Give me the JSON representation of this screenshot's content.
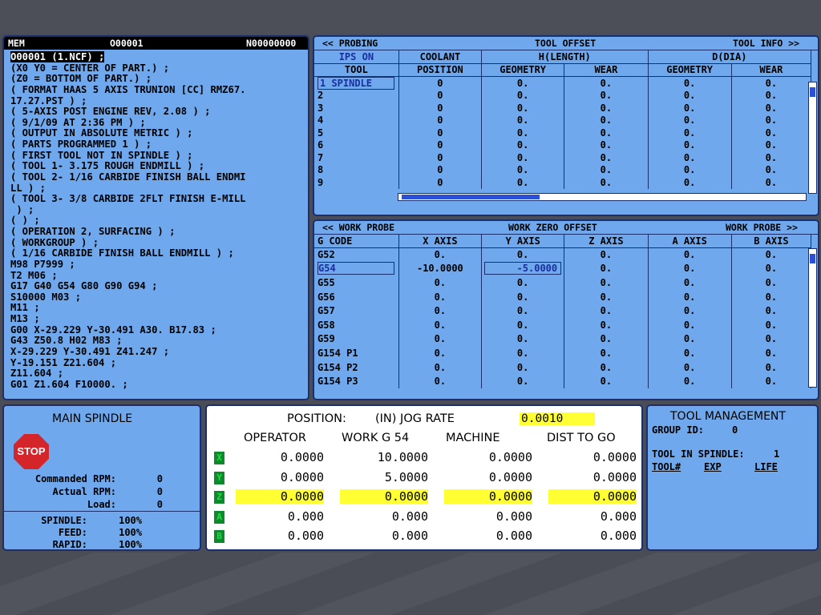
{
  "program": {
    "mode": "MEM",
    "number": "O00001",
    "seq": "N00000000",
    "lines": [
      "O00001 (1.NCF) ;",
      "(X0 Y0 = CENTER OF PART.) ;",
      "(Z0 = BOTTOM OF PART.) ;",
      "( FORMAT HAAS 5 AXIS TRUNION [CC] RMZ67.",
      "17.27.PST ) ;",
      "( 5-AXIS POST ENGINE REV, 2.08 ) ;",
      "( 9/1/09 AT 2:36 PM ) ;",
      "( OUTPUT IN ABSOLUTE METRIC ) ;",
      "( PARTS PROGRAMMED 1 ) ;",
      "( FIRST TOOL NOT IN SPINDLE ) ;",
      "( TOOL 1- 3.175 ROUGH ENDMILL ) ;",
      "( TOOL 2- 1/16 CARBIDE FINISH BALL ENDMI",
      "LL ) ;",
      "( TOOL 3- 3/8 CARBIDE 2FLT FINISH E-MILL",
      " ) ;",
      "( ) ;",
      "( OPERATION 2, SURFACING ) ;",
      "( WORKGROUP ) ;",
      "( 1/16 CARBIDE FINISH BALL ENDMILL ) ;",
      "M98 P7999 ;",
      "T2 M06 ;",
      "G17 G40 G54 G80 G90 G94 ;",
      "S10000 M03 ;",
      "M11 ;",
      "M13 ;",
      "G00 X-29.229 Y-30.491 A30. B17.83 ;",
      "G43 Z50.8 H02 M83 ;",
      "X-29.229 Y-30.491 Z41.247 ;",
      "Y-19.151 Z21.604 ;",
      "Z11.604 ;",
      "G01 Z1.604 F10000. ;"
    ]
  },
  "tool_offset": {
    "left": "<< PROBING",
    "title": "TOOL OFFSET",
    "right": "TOOL INFO >>",
    "ips": "IPS ON",
    "coolant": "COOLANT",
    "h": "H(LENGTH)",
    "d": "D(DIA)",
    "cols": [
      "TOOL",
      "POSITION",
      "GEOMETRY",
      "WEAR",
      "GEOMETRY",
      "WEAR"
    ],
    "rows": [
      [
        "1 SPINDLE",
        "0",
        "0.",
        "0.",
        "0.",
        "0."
      ],
      [
        "2",
        "0",
        "0.",
        "0.",
        "0.",
        "0."
      ],
      [
        "3",
        "0",
        "0.",
        "0.",
        "0.",
        "0."
      ],
      [
        "4",
        "0",
        "0.",
        "0.",
        "0.",
        "0."
      ],
      [
        "5",
        "0",
        "0.",
        "0.",
        "0.",
        "0."
      ],
      [
        "6",
        "0",
        "0.",
        "0.",
        "0.",
        "0."
      ],
      [
        "7",
        "0",
        "0.",
        "0.",
        "0.",
        "0."
      ],
      [
        "8",
        "0",
        "0.",
        "0.",
        "0.",
        "0."
      ],
      [
        "9",
        "0",
        "0.",
        "0.",
        "0.",
        "0."
      ]
    ]
  },
  "work_offset": {
    "left": "<< WORK PROBE",
    "title": "WORK ZERO OFFSET",
    "right": "WORK PROBE >>",
    "cols": [
      "G CODE",
      "X AXIS",
      "Y AXIS",
      "Z AXIS",
      "A AXIS",
      "B AXIS"
    ],
    "rows": [
      [
        "G52",
        "0.",
        "0.",
        "0.",
        "0.",
        "0."
      ],
      [
        "G54",
        "-10.0000",
        "-5.0000",
        "0.",
        "0.",
        "0."
      ],
      [
        "G55",
        "0.",
        "0.",
        "0.",
        "0.",
        "0."
      ],
      [
        "G56",
        "0.",
        "0.",
        "0.",
        "0.",
        "0."
      ],
      [
        "G57",
        "0.",
        "0.",
        "0.",
        "0.",
        "0."
      ],
      [
        "G58",
        "0.",
        "0.",
        "0.",
        "0.",
        "0."
      ],
      [
        "G59",
        "0.",
        "0.",
        "0.",
        "0.",
        "0."
      ],
      [
        "G154 P1",
        "0.",
        "0.",
        "0.",
        "0.",
        "0."
      ],
      [
        "G154 P2",
        "0.",
        "0.",
        "0.",
        "0.",
        "0."
      ],
      [
        "G154 P3",
        "0.",
        "0.",
        "0.",
        "0.",
        "0."
      ]
    ]
  },
  "spindle": {
    "title": "MAIN SPINDLE",
    "stop": "STOP",
    "cmd_label": "Commanded RPM:",
    "cmd": "0",
    "act_label": "Actual RPM:",
    "act": "0",
    "load_label": "Load:",
    "load": "0",
    "spindle_label": "SPINDLE:",
    "spindle_pct": "100%",
    "feed_label": "FEED:",
    "feed_pct": "100%",
    "rapid_label": "RAPID:",
    "rapid_pct": "100%"
  },
  "position": {
    "title": "POSITION:",
    "units": "(IN) JOG RATE",
    "jog": "0.0010",
    "heads": [
      "OPERATOR",
      "WORK  G 54",
      "MACHINE",
      "DIST TO GO"
    ],
    "axes": [
      {
        "a": "X",
        "v": [
          "0.0000",
          "10.0000",
          "0.0000",
          "0.0000"
        ]
      },
      {
        "a": "Y",
        "v": [
          "0.0000",
          "5.0000",
          "0.0000",
          "0.0000"
        ]
      },
      {
        "a": "Z",
        "v": [
          "0.0000",
          "0.0000",
          "0.0000",
          "0.0000"
        ]
      },
      {
        "a": "A",
        "v": [
          "0.000",
          "0.000",
          "0.000",
          "0.000"
        ]
      },
      {
        "a": "B",
        "v": [
          "0.000",
          "0.000",
          "0.000",
          "0.000"
        ]
      }
    ]
  },
  "tool_mgmt": {
    "title": "TOOL MANAGEMENT",
    "group_label": "GROUP ID:",
    "group": "0",
    "spindle_label": "TOOL IN SPINDLE:",
    "spindle_tool": "1",
    "c1": "TOOL#",
    "c2": "EXP",
    "c3": "LIFE"
  }
}
